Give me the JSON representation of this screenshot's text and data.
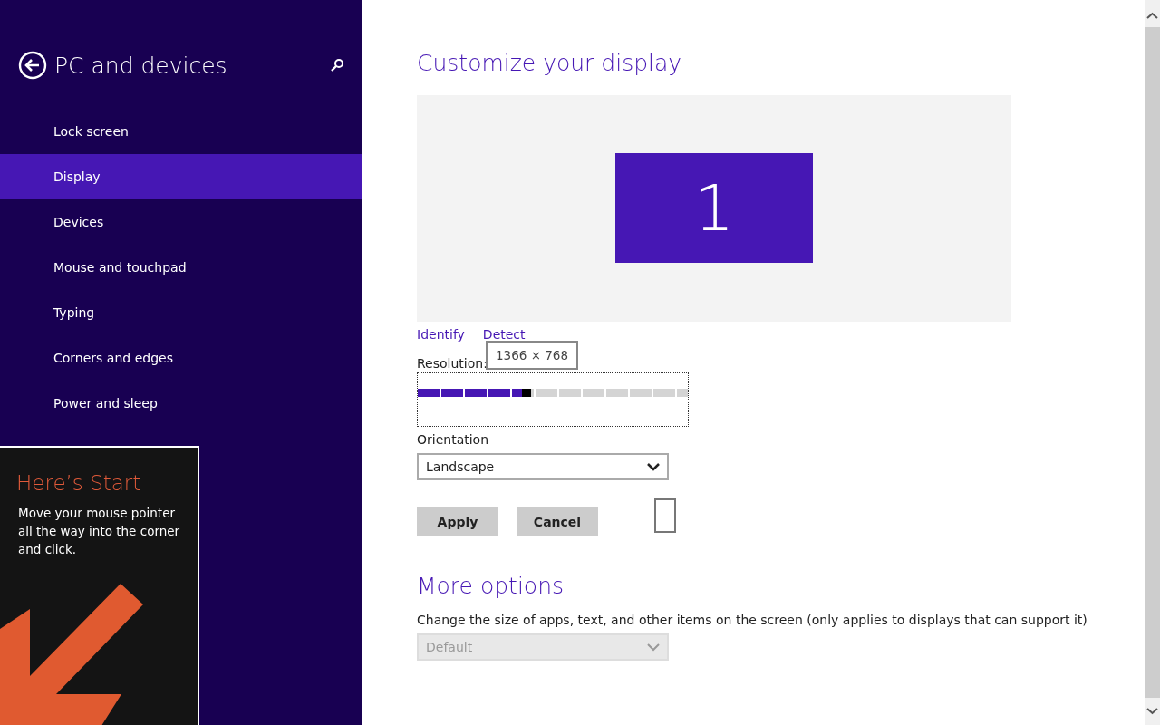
{
  "sidebar": {
    "title": "PC and devices",
    "items": [
      {
        "label": "Lock screen",
        "selected": false
      },
      {
        "label": "Display",
        "selected": true
      },
      {
        "label": "Devices",
        "selected": false
      },
      {
        "label": "Mouse and touchpad",
        "selected": false
      },
      {
        "label": "Typing",
        "selected": false
      },
      {
        "label": "Corners and edges",
        "selected": false
      },
      {
        "label": "Power and sleep",
        "selected": false
      }
    ]
  },
  "tip": {
    "title": "Here’s Start",
    "text": "Move your mouse pointer all the way into the corner and click."
  },
  "main": {
    "title": "Customize your display",
    "monitor": "1",
    "links": [
      "Identify",
      "Detect"
    ],
    "resolution": {
      "label": "Resolution:",
      "tooltip": "1366 × 768",
      "level": 0.42
    },
    "orientation": {
      "label": "Orientation",
      "value": "Landscape"
    },
    "buttons": [
      "Apply",
      "Cancel"
    ],
    "more_title": "More options",
    "size_label": "Change the size of apps, text, and other items on the screen (only applies to displays that can support it)",
    "size_select": {
      "value": "Default",
      "disabled": true
    }
  }
}
